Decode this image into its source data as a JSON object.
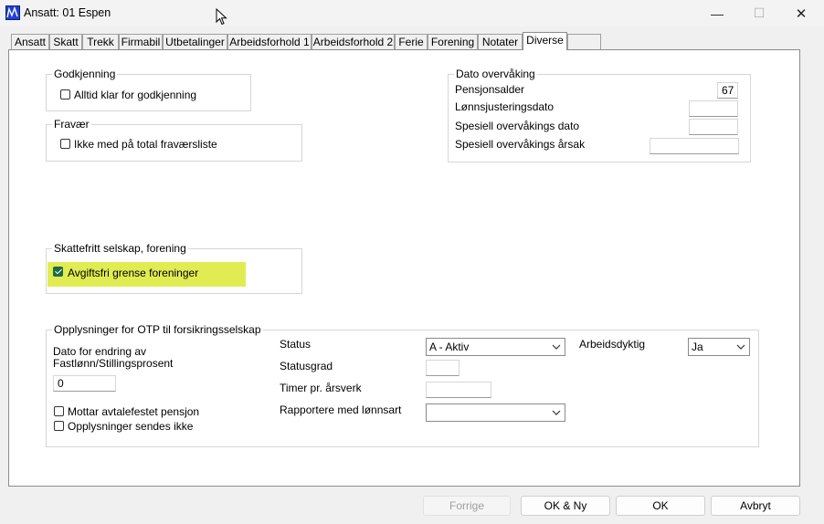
{
  "window": {
    "title": "Ansatt: 01 Espen",
    "minimize_glyph": "—",
    "maximize_glyph": "☐",
    "close_glyph": "✕"
  },
  "tabs": [
    {
      "label": "Ansatt"
    },
    {
      "label": "Skatt"
    },
    {
      "label": "Trekk"
    },
    {
      "label": "Firmabil"
    },
    {
      "label": "Utbetalinger"
    },
    {
      "label": "Arbeidsforhold 1"
    },
    {
      "label": "Arbeidsforhold 2"
    },
    {
      "label": "Ferie"
    },
    {
      "label": "Forening"
    },
    {
      "label": "Notater"
    },
    {
      "label": "Diverse",
      "active": true
    },
    {
      "label": ""
    }
  ],
  "godkjenning": {
    "title": "Godkjenning",
    "checkbox_label": "Alltid klar for godkjenning",
    "checked": false
  },
  "fravaer": {
    "title": "Fravær",
    "checkbox_label": "Ikke med på total fraværsliste",
    "checked": false
  },
  "dato_overvaking": {
    "title": "Dato overvåking",
    "pensjonsalder_label": "Pensjonsalder",
    "pensjonsalder_value": "67",
    "lonnsjustering_label": "Lønnsjusteringsdato",
    "lonnsjustering_value": "",
    "spesiell_dato_label": "Spesiell overvåkings dato",
    "spesiell_dato_value": "",
    "spesiell_arsak_label": "Spesiell overvåkings årsak",
    "spesiell_arsak_value": ""
  },
  "skattefritt": {
    "title": "Skattefritt selskap, forening",
    "checkbox_label": "Avgiftsfri grense foreninger",
    "checked": true,
    "highlight_color": "#e1ec53"
  },
  "otp": {
    "title": "Opplysninger for OTP til forsikringsselskap",
    "dato_label_line1": "Dato for endring av",
    "dato_label_line2": "Fastlønn/Stillingsprosent",
    "dato_value": "0",
    "mottar_label": "Mottar avtalefestet pensjon",
    "mottar_checked": false,
    "sendes_ikke_label": "Opplysninger sendes ikke",
    "sendes_ikke_checked": false,
    "status_label": "Status",
    "status_value": "A  - Aktiv",
    "statusgrad_label": "Statusgrad",
    "statusgrad_value": "",
    "timer_label": "Timer pr. årsverk",
    "timer_value": "",
    "rapportere_label": "Rapportere med lønnsart",
    "rapportere_value": "",
    "arbeidsdyktig_label": "Arbeidsdyktig",
    "arbeidsdyktig_value": "Ja"
  },
  "footer": {
    "forrige": "Forrige",
    "ok_ny": "OK & Ny",
    "ok": "OK",
    "avbryt": "Avbryt"
  }
}
